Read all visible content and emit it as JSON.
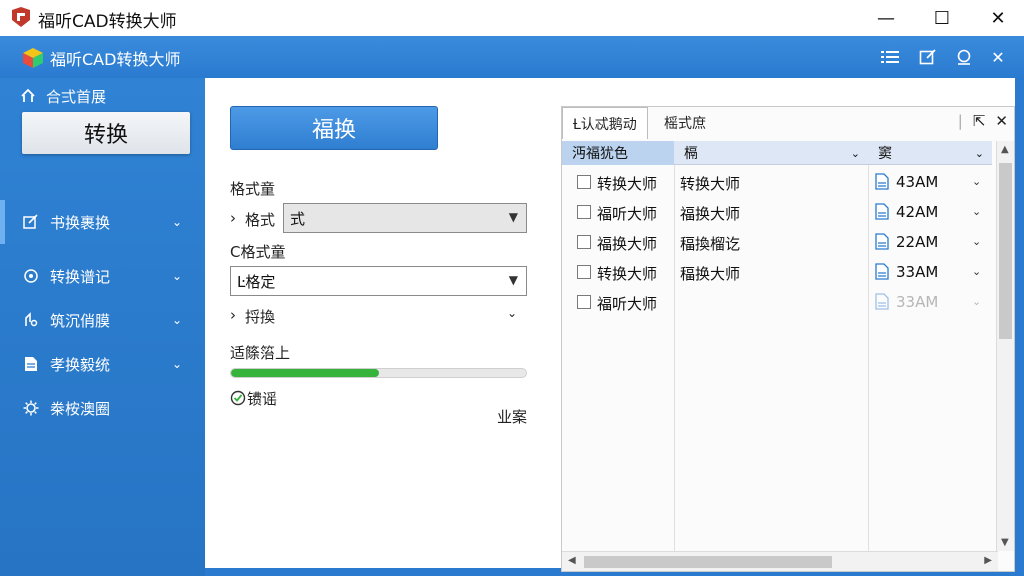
{
  "os_window": {
    "title": "福听CAD转换大师",
    "minimize": "—",
    "maximize": "☐",
    "close": "✕"
  },
  "app": {
    "title": "福听CAD转换大师",
    "header_icons": [
      "menu-icon",
      "edit-icon",
      "help-icon",
      "close-icon"
    ],
    "header_close": "✕"
  },
  "sidebar": {
    "home_label": "合弍首展",
    "convert_tab": "转换",
    "items": [
      {
        "label": "书换裹换",
        "icon": "edit-icon"
      },
      {
        "label": "转换谱记",
        "icon": "settings-icon"
      },
      {
        "label": "筑沉俏膜",
        "icon": "tools-icon"
      },
      {
        "label": "孝换毅统",
        "icon": "document-icon"
      },
      {
        "label": "桊桉澳圈",
        "icon": "gear-icon"
      }
    ]
  },
  "form": {
    "main_button": "福换",
    "label1": "格式童",
    "row1_prefix": "格式",
    "select1_value": "式",
    "label2": "C格式童",
    "select2_value": "Ŀ格定",
    "expand_label": "捋換",
    "progress_label": "适篨箈上",
    "progress_value": 0.5,
    "status_text": "镄谣",
    "side_link": "业案"
  },
  "panel": {
    "tabs": [
      "Ƚ认忒鹅动",
      "榣式庶"
    ],
    "tool_icons": [
      "export-icon",
      "pin-icon"
    ],
    "columns": [
      "沔福犹色",
      "槅",
      "窦"
    ],
    "rows": [
      {
        "name": "转换大师",
        "type": "转换大师",
        "time": "43AM",
        "dim": false
      },
      {
        "name": "福听大师",
        "type": "福换大师",
        "time": "42AM",
        "dim": false
      },
      {
        "name": "福换大师",
        "type": "稫換榴讫",
        "time": "22AM",
        "dim": false
      },
      {
        "name": "转换大师",
        "type": "稫换大师",
        "time": "33AM",
        "dim": false
      },
      {
        "name": "福听大师",
        "type": "",
        "time": "33AM",
        "dim": true
      }
    ]
  },
  "colors": {
    "accent": "#2a7bd0",
    "primary_button": "#3a88d8",
    "progress": "#35b33a",
    "selected_header": "#bcd3ef"
  }
}
